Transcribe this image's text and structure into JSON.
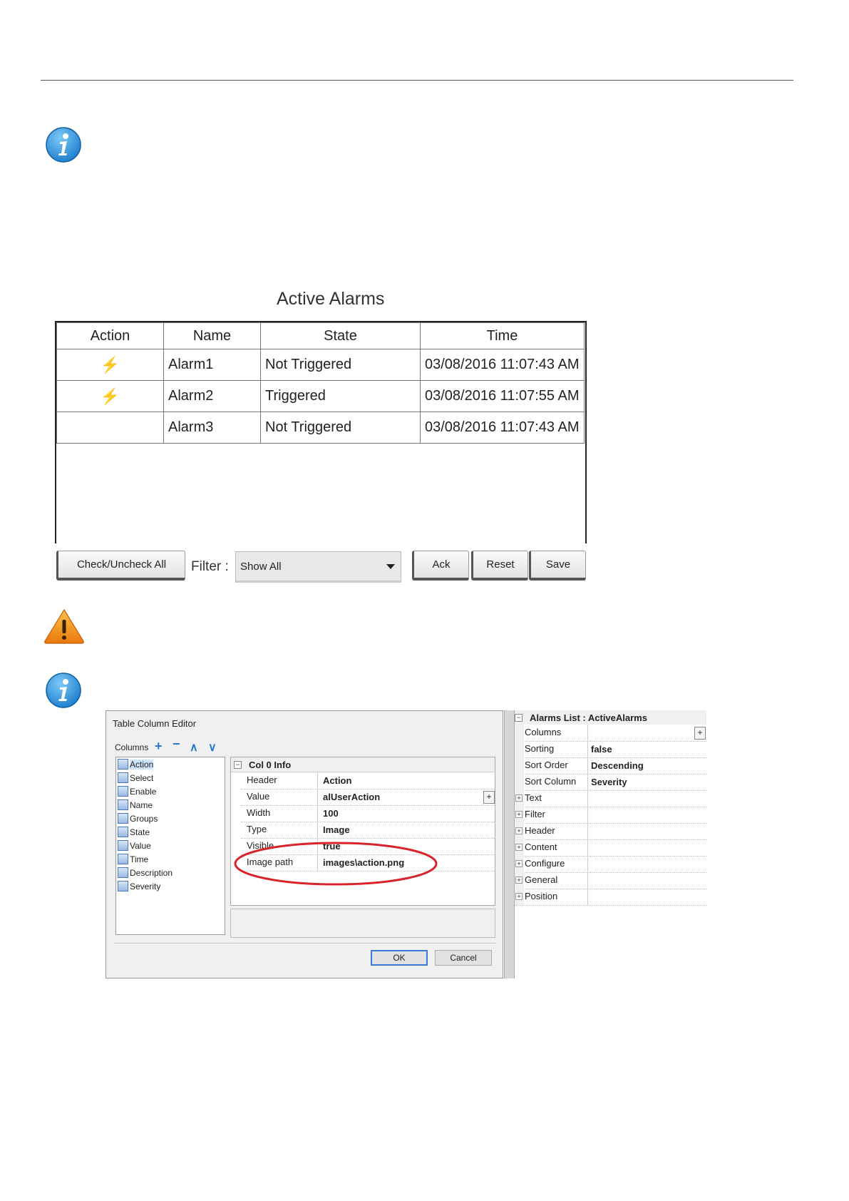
{
  "active_alarms": {
    "title": "Active Alarms",
    "columns": [
      "Action",
      "Name",
      "State",
      "Time"
    ],
    "rows": [
      {
        "action_icon": "lightning-icon",
        "name": "Alarm1",
        "state": "Not Triggered",
        "time": "03/08/2016 11:07:43 AM"
      },
      {
        "action_icon": "lightning-icon",
        "name": "Alarm2",
        "state": "Triggered",
        "time": "03/08/2016 11:07:55 AM"
      },
      {
        "action_icon": "",
        "name": "Alarm3",
        "state": "Not Triggered",
        "time": "03/08/2016 11:07:43 AM"
      }
    ],
    "check_all_label": "Check/Uncheck All",
    "filter_label": "Filter :",
    "filter_value": "Show All",
    "ack_label": "Ack",
    "reset_label": "Reset",
    "save_label": "Save"
  },
  "icons": {
    "info": "info-icon",
    "warning": "warning-icon"
  },
  "table_column_editor": {
    "title": "Table Column Editor",
    "columns_label": "Columns",
    "columns": [
      "Action",
      "Select",
      "Enable",
      "Name",
      "Groups",
      "State",
      "Value",
      "Time",
      "Description",
      "Severity"
    ],
    "group_title": "Col 0 Info",
    "properties": [
      {
        "key": "Header",
        "value": "Action"
      },
      {
        "key": "Value",
        "value": "alUserAction"
      },
      {
        "key": "Width",
        "value": "100"
      },
      {
        "key": "Type",
        "value": "Image"
      },
      {
        "key": "Visible",
        "value": "true"
      },
      {
        "key": "Image path",
        "value": "images\\action.png"
      }
    ],
    "ok_label": "OK",
    "cancel_label": "Cancel"
  },
  "alarms_list": {
    "title": "Alarms List : ActiveAlarms",
    "properties": [
      {
        "key": "Columns",
        "value": ""
      },
      {
        "key": "Sorting",
        "value": "false"
      },
      {
        "key": "Sort Order",
        "value": "Descending"
      },
      {
        "key": "Sort Column",
        "value": "Severity"
      },
      {
        "key": "Text",
        "value": ""
      },
      {
        "key": "Filter",
        "value": ""
      },
      {
        "key": "Header",
        "value": ""
      },
      {
        "key": "Content",
        "value": ""
      },
      {
        "key": "Configure",
        "value": ""
      },
      {
        "key": "General",
        "value": ""
      },
      {
        "key": "Position",
        "value": ""
      }
    ]
  },
  "colors": {
    "highlight_ellipse": "#d9232a",
    "info_blue": "#1e88d8",
    "warning_orange": "#f39a1b",
    "lightning": "#f5b31b"
  }
}
